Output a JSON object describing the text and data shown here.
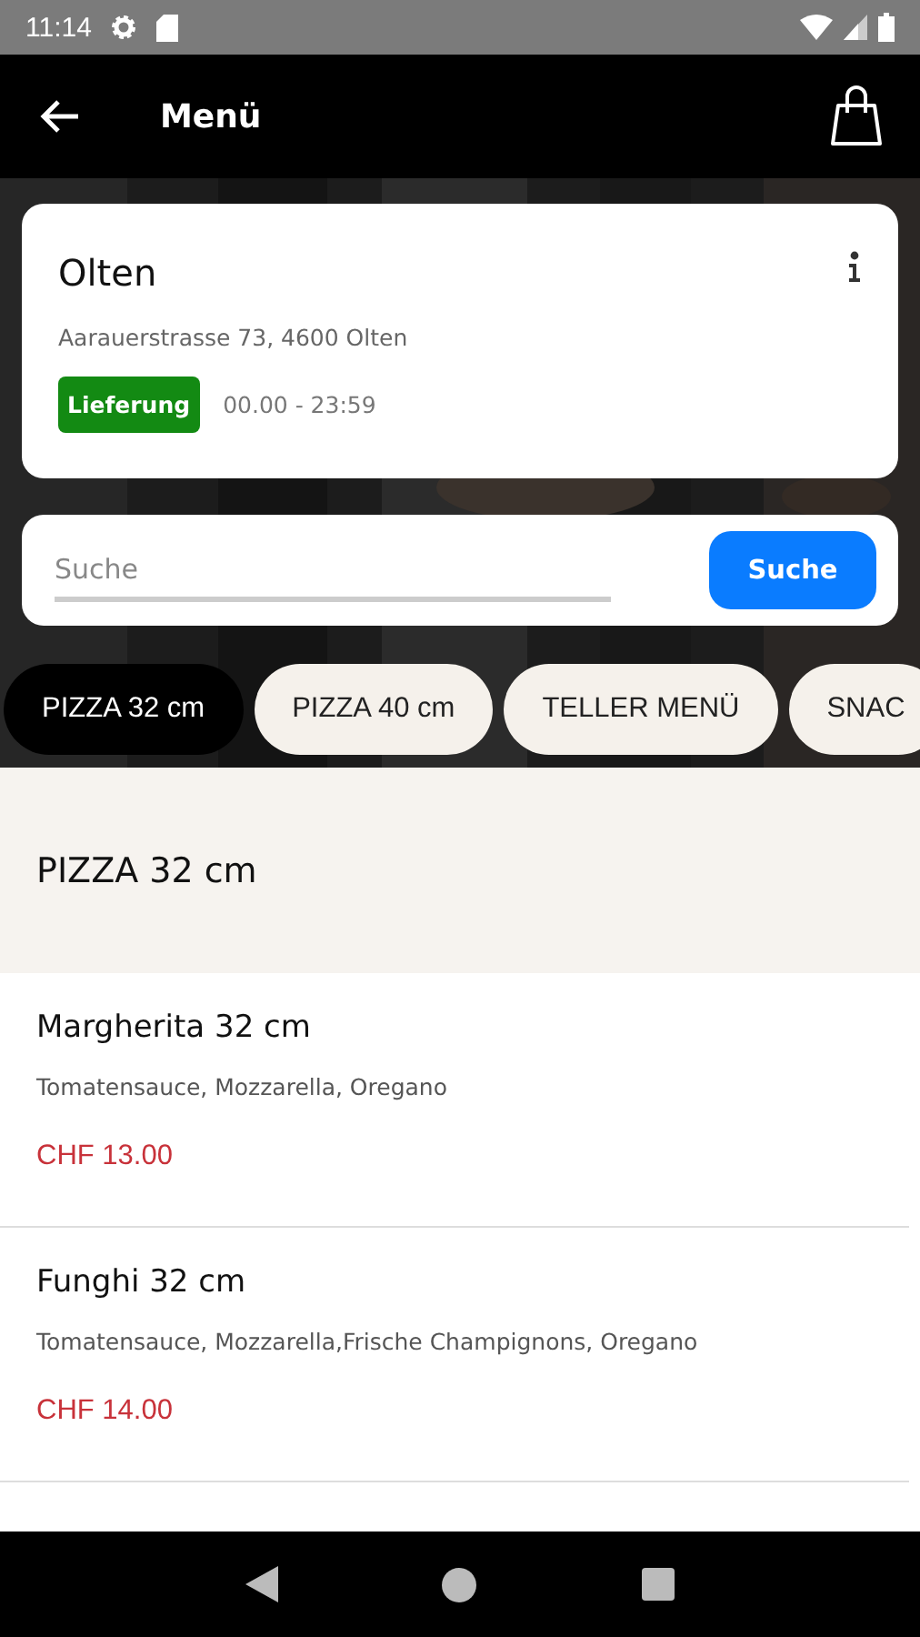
{
  "status_bar": {
    "time": "11:14"
  },
  "toolbar": {
    "title": "Menü"
  },
  "store": {
    "name": "Olten",
    "address": "Aarauerstrasse 73, 4600 Olten",
    "badge": "Lieferung",
    "hours": "00.00 - 23:59"
  },
  "search": {
    "placeholder": "Suche",
    "button": "Suche"
  },
  "tabs": [
    {
      "label": "PIZZA 32 cm",
      "selected": true
    },
    {
      "label": "PIZZA 40 cm",
      "selected": false
    },
    {
      "label": "TELLER MENÜ",
      "selected": false
    },
    {
      "label": "SNAC",
      "selected": false
    }
  ],
  "section": {
    "title": "PIZZA 32 cm"
  },
  "items": [
    {
      "name": "Margherita 32 cm",
      "description": "Tomatensauce, Mozzarella, Oregano",
      "price": "CHF 13.00"
    },
    {
      "name": "Funghi 32 cm",
      "description": "Tomatensauce, Mozzarella,Frische Champignons, Oregano",
      "price": "CHF 14.00"
    }
  ]
}
